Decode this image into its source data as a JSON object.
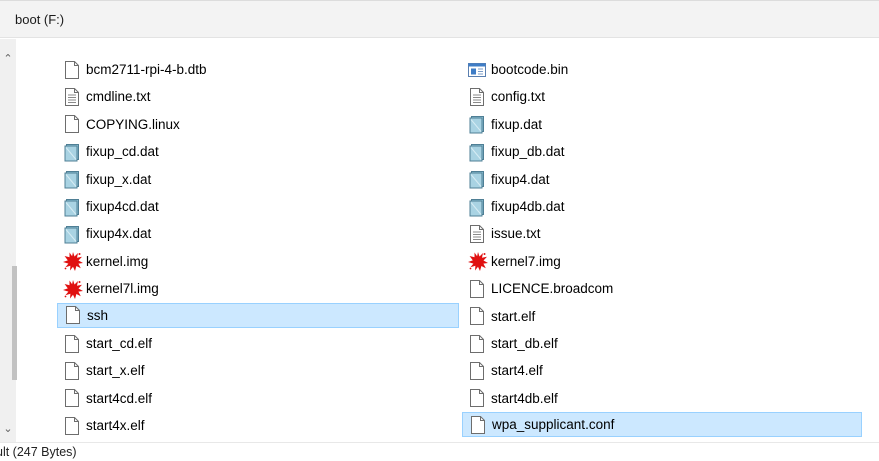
{
  "window": {
    "title": "boot (F:)"
  },
  "status": {
    "text": "ult (247 Bytes)"
  },
  "files_left": [
    {
      "name": "bcm2711-rpi-4-b.dtb",
      "icon": "blank-file-icon"
    },
    {
      "name": "cmdline.txt",
      "icon": "text-file-icon"
    },
    {
      "name": "COPYING.linux",
      "icon": "blank-file-icon"
    },
    {
      "name": "fixup_cd.dat",
      "icon": "dat-file-icon"
    },
    {
      "name": "fixup_x.dat",
      "icon": "dat-file-icon"
    },
    {
      "name": "fixup4cd.dat",
      "icon": "dat-file-icon"
    },
    {
      "name": "fixup4x.dat",
      "icon": "dat-file-icon"
    },
    {
      "name": "kernel.img",
      "icon": "splat-img-icon"
    },
    {
      "name": "kernel7l.img",
      "icon": "splat-img-icon"
    },
    {
      "name": "ssh",
      "icon": "blank-file-icon",
      "selected": true
    },
    {
      "name": "start_cd.elf",
      "icon": "blank-file-icon"
    },
    {
      "name": "start_x.elf",
      "icon": "blank-file-icon"
    },
    {
      "name": "start4cd.elf",
      "icon": "blank-file-icon"
    },
    {
      "name": "start4x.elf",
      "icon": "blank-file-icon"
    }
  ],
  "files_right": [
    {
      "name": "bootcode.bin",
      "icon": "bin-file-icon"
    },
    {
      "name": "config.txt",
      "icon": "text-file-icon"
    },
    {
      "name": "fixup.dat",
      "icon": "dat-file-icon"
    },
    {
      "name": "fixup_db.dat",
      "icon": "dat-file-icon"
    },
    {
      "name": "fixup4.dat",
      "icon": "dat-file-icon"
    },
    {
      "name": "fixup4db.dat",
      "icon": "dat-file-icon"
    },
    {
      "name": "issue.txt",
      "icon": "text-file-icon"
    },
    {
      "name": "kernel7.img",
      "icon": "splat-img-icon"
    },
    {
      "name": "LICENCE.broadcom",
      "icon": "blank-file-icon"
    },
    {
      "name": "start.elf",
      "icon": "blank-file-icon"
    },
    {
      "name": "start_db.elf",
      "icon": "blank-file-icon"
    },
    {
      "name": "start4.elf",
      "icon": "blank-file-icon"
    },
    {
      "name": "start4db.elf",
      "icon": "blank-file-icon"
    },
    {
      "name": "wpa_supplicant.conf",
      "icon": "blank-file-icon",
      "selected": true
    }
  ],
  "colors": {
    "selection": "#cce8ff",
    "selection_border": "#99d1ff",
    "splat": "#e01010",
    "dat_icon": "#7fb6cf"
  }
}
